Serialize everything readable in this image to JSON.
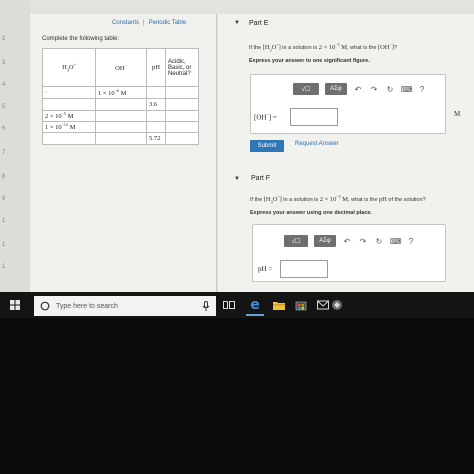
{
  "left": {
    "links": [
      "Constants",
      "Periodic Table"
    ],
    "instruction": "Complete the following table:",
    "table": {
      "headers": [
        "H3O+",
        "OH-",
        "pH",
        "Acidic, Basic, or Neutral?"
      ],
      "rows": [
        [
          "",
          "1 × 10^-6 M",
          "",
          ""
        ],
        [
          "",
          "",
          "3.6",
          ""
        ],
        [
          "2 × 10^-5 M",
          "",
          "",
          ""
        ],
        [
          "1 × 10^-12 M",
          "",
          "",
          ""
        ],
        [
          "",
          "",
          "5.72",
          ""
        ]
      ]
    }
  },
  "partE": {
    "label": "Part E",
    "question": "If the [H3O+] in a solution is 2 × 10^-5 M, what is the [OH-]?",
    "instruction": "Express your answer to one significant figure.",
    "answer_label": "[OH-] =",
    "answer_value": "",
    "unit": "M",
    "submit": "Submit",
    "request": "Request Answer"
  },
  "partF": {
    "label": "Part F",
    "question": "If the [H3O+] in a solution is 2 × 10^-5 M, what is the pH of the solution?",
    "instruction": "Express your answer using one decimal place.",
    "answer_label": "pH =",
    "answer_value": ""
  },
  "toolbar": {
    "template": "√☐",
    "symbols": "ΑΣφ",
    "icons": [
      "undo-icon",
      "redo-icon",
      "reset-icon",
      "keyboard-icon",
      "help-icon"
    ],
    "help": "?"
  },
  "taskbar": {
    "search_placeholder": "Type here to search"
  },
  "line_numbers": [
    "2",
    "3",
    "4",
    "5",
    "6",
    "7",
    "8",
    "9",
    "1",
    "1",
    "1"
  ]
}
